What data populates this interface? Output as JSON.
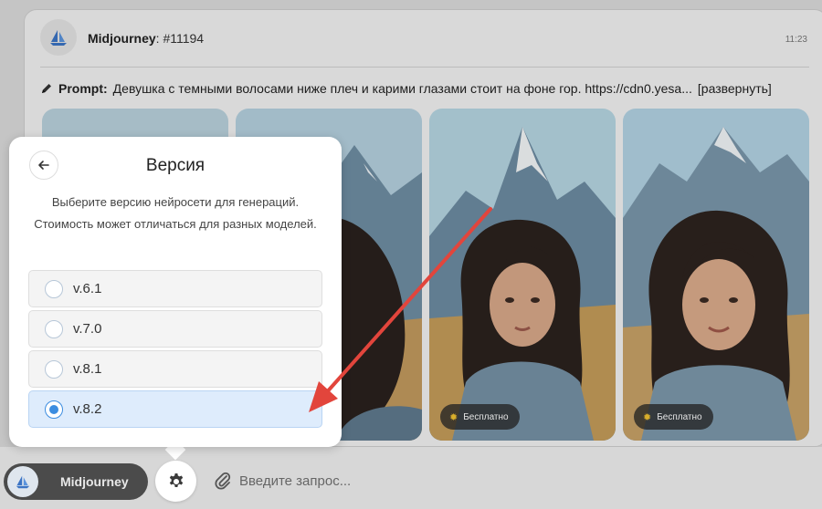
{
  "message": {
    "bot_name": "Midjourney",
    "tag": "#11194",
    "time": "11:23",
    "prompt_label": "Prompt:",
    "prompt_text": "Девушка с темными волосами ниже плеч и карими глазами стоит на фоне гор. https://cdn0.yesa...",
    "expand_link": "[развернуть]",
    "images": [
      {
        "badge": ""
      },
      {
        "badge": ""
      },
      {
        "badge": "Бесплатно"
      },
      {
        "badge": "Бесплатно"
      }
    ]
  },
  "popup": {
    "title": "Версия",
    "description": "Выберите версию нейросети для генераций. Стоимость может отличаться для разных моделей.",
    "options": [
      {
        "label": "v.6.1",
        "selected": false
      },
      {
        "label": "v.7.0",
        "selected": false
      },
      {
        "label": "v.8.1",
        "selected": false
      },
      {
        "label": "v.8.2",
        "selected": true
      }
    ]
  },
  "bottom_bar": {
    "model_name": "Midjourney",
    "input_placeholder": "Введите запрос..."
  },
  "colors": {
    "accent": "#3c8de0",
    "selected_bg": "#deecfc",
    "annotation_arrow": "#e2453c",
    "badge_icon": "#f2c230"
  },
  "icons": {
    "back": "arrow-left-icon",
    "settings": "gear-icon",
    "attach": "paperclip-icon",
    "prompt": "pencil-icon",
    "bot": "sailboat-logo-icon"
  }
}
